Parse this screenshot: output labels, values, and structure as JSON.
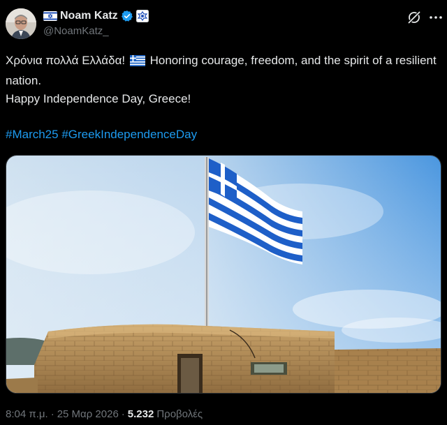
{
  "author": {
    "name": "Noam Katz",
    "handle": "@NoamKatz_"
  },
  "tweet": {
    "line1_before_flag": "Χρόνια πολλά Ελλάδα!",
    "line1_after_flag": "Honoring courage, freedom, and the spirit of a resilient nation.",
    "line2": "Happy Independence Day, Greece!",
    "hashtags": [
      "#March25",
      "#GreekIndependenceDay"
    ]
  },
  "meta": {
    "time": "8:04 π.μ.",
    "separator": "·",
    "date": "25 Μαρ 2026",
    "views_count": "5.232",
    "views_label": "Προβολές"
  },
  "icons": {
    "verified": "verified-badge-icon",
    "israel_flag": "israel-flag-icon",
    "affiliate": "affiliate-badge-icon",
    "grok": "grok-icon",
    "greek_flag": "greek-flag-icon"
  },
  "colors": {
    "background": "#000000",
    "text": "#e7e9ea",
    "secondary": "#71767b",
    "link": "#1d9bf0",
    "verified": "#1d9bf0"
  }
}
